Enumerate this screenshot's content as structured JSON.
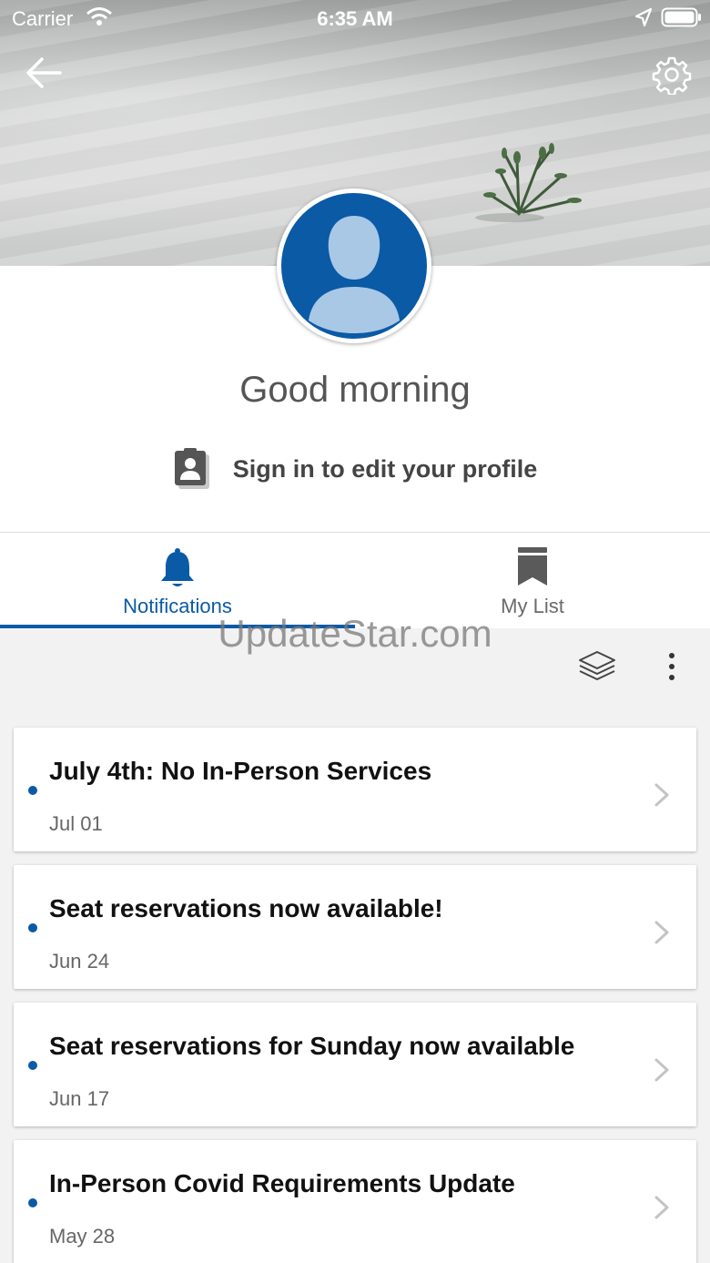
{
  "status_bar": {
    "carrier": "Carrier",
    "time": "6:35 AM"
  },
  "profile": {
    "greeting": "Good morning",
    "sign_in_label": "Sign in to edit your profile"
  },
  "tabs": [
    {
      "label": "Notifications",
      "icon": "bell-icon",
      "selected": true
    },
    {
      "label": "My List",
      "icon": "bookmark-icon",
      "selected": false
    }
  ],
  "watermark": "UpdateStar.com",
  "notifications": [
    {
      "title": "July 4th: No In-Person Services",
      "date": "Jul 01",
      "unread": true
    },
    {
      "title": "Seat reservations now available!",
      "date": "Jun 24",
      "unread": true
    },
    {
      "title": "Seat reservations for Sunday now available",
      "date": "Jun 17",
      "unread": true
    },
    {
      "title": "In-Person Covid Requirements Update",
      "date": "May 28",
      "unread": true
    }
  ],
  "colors": {
    "accent": "#0a5aa6",
    "avatar_fg": "#a9c8e6",
    "tab_inactive": "#6a6a6a"
  }
}
